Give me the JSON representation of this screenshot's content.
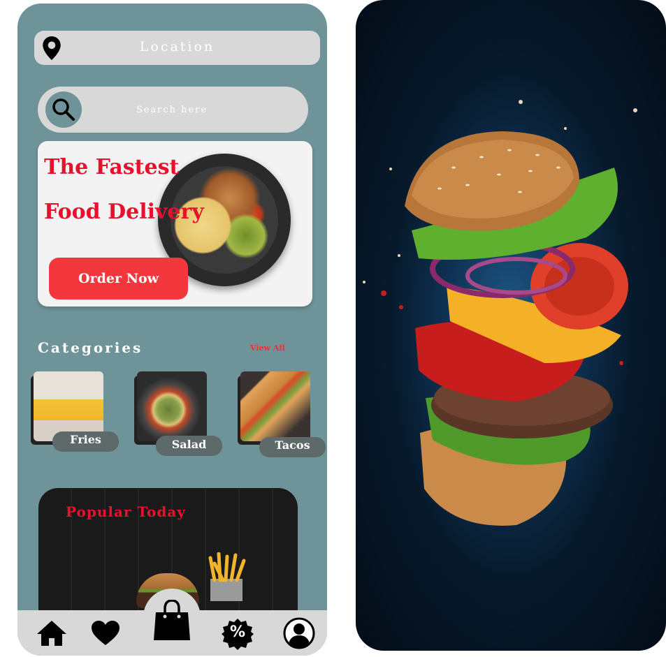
{
  "location": {
    "label": "Location"
  },
  "search": {
    "placeholder": "Search here"
  },
  "promo": {
    "title_line1": "The Fastest",
    "title_line2": "Food Delivery",
    "button_label": "Order Now"
  },
  "categories": {
    "title": "Categories",
    "view_all": "View All",
    "items": [
      {
        "label": "Fries"
      },
      {
        "label": "Salad"
      },
      {
        "label": "Tacos"
      }
    ]
  },
  "popular": {
    "title": "Popular Today"
  },
  "bottom_nav": {
    "icons": [
      "home-icon",
      "heart-icon",
      "shopping-bag-icon",
      "discount-icon",
      "profile-icon"
    ],
    "discount_symbol": "%"
  },
  "colors": {
    "app_background": "#6e9499",
    "accent_red": "#f4373d",
    "title_red": "#e8112d",
    "field_gray": "#d8d8d8"
  }
}
